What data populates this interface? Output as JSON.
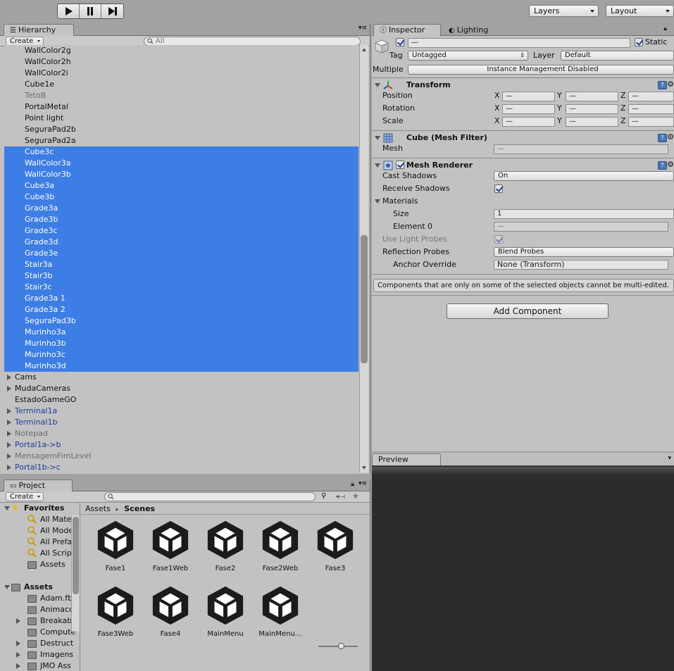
{
  "toolbar": {
    "layers_label": "Layers",
    "layout_label": "Layout"
  },
  "hierarchy": {
    "tab_label": "Hierarchy",
    "create_label": "Create",
    "search_placeholder": "All",
    "rows": [
      {
        "label": "WallColor2g",
        "state": "child"
      },
      {
        "label": "WallColor2h",
        "state": "child"
      },
      {
        "label": "WallColor2i",
        "state": "child"
      },
      {
        "label": "Cube1e",
        "state": "child"
      },
      {
        "label": "TetoB",
        "state": "child-dim"
      },
      {
        "label": "PortalMetal",
        "state": "child"
      },
      {
        "label": "Point light",
        "state": "child"
      },
      {
        "label": "SeguraPad2b",
        "state": "child"
      },
      {
        "label": "SeguraPad2a",
        "state": "child"
      },
      {
        "label": "Cube3c",
        "state": "sel"
      },
      {
        "label": "WallColor3a",
        "state": "sel"
      },
      {
        "label": "WallColor3b",
        "state": "sel"
      },
      {
        "label": "Cube3a",
        "state": "sel"
      },
      {
        "label": "Cube3b",
        "state": "sel"
      },
      {
        "label": "Grade3a",
        "state": "sel"
      },
      {
        "label": "Grade3b",
        "state": "sel"
      },
      {
        "label": "Grade3c",
        "state": "sel"
      },
      {
        "label": "Grade3d",
        "state": "sel"
      },
      {
        "label": "Grade3e",
        "state": "sel"
      },
      {
        "label": "Stair3a",
        "state": "sel"
      },
      {
        "label": "Stair3b",
        "state": "sel"
      },
      {
        "label": "Stair3c",
        "state": "sel"
      },
      {
        "label": "Grade3a 1",
        "state": "sel"
      },
      {
        "label": "Grade3a 2",
        "state": "sel"
      },
      {
        "label": "SeguraPad3b",
        "state": "sel"
      },
      {
        "label": "Murinho3a",
        "state": "sel"
      },
      {
        "label": "Murinho3b",
        "state": "sel"
      },
      {
        "label": "Murinho3c",
        "state": "sel"
      },
      {
        "label": "Murinho3d",
        "state": "sel"
      },
      {
        "label": "Cams",
        "state": "root-fold"
      },
      {
        "label": "MudaCameras",
        "state": "root-fold"
      },
      {
        "label": "EstadoGameGO",
        "state": "root"
      },
      {
        "label": "Terminal1a",
        "state": "root-fold-link"
      },
      {
        "label": "Terminal1b",
        "state": "root-fold-link"
      },
      {
        "label": "Notepad",
        "state": "root-fold-dim"
      },
      {
        "label": "Portal1a->b",
        "state": "root-fold-link"
      },
      {
        "label": "MensagemFimLevel",
        "state": "root-fold-dim"
      },
      {
        "label": "Portal1b->c",
        "state": "root-fold-link"
      }
    ]
  },
  "project": {
    "tab_label": "Project",
    "create_label": "Create",
    "tree": [
      {
        "label": "Favorites",
        "kind": "star",
        "bold": true,
        "indent": 0,
        "fold": "open"
      },
      {
        "label": "All Mater",
        "kind": "search",
        "bold": false,
        "indent": 1,
        "fold": ""
      },
      {
        "label": "All Mode",
        "kind": "search",
        "bold": false,
        "indent": 1,
        "fold": ""
      },
      {
        "label": "All Prefa",
        "kind": "search",
        "bold": false,
        "indent": 1,
        "fold": ""
      },
      {
        "label": "All Script",
        "kind": "search",
        "bold": false,
        "indent": 1,
        "fold": ""
      },
      {
        "label": "Assets",
        "kind": "folder",
        "bold": false,
        "indent": 1,
        "fold": ""
      },
      {
        "label": "",
        "kind": "none",
        "bold": false,
        "indent": 0,
        "fold": ""
      },
      {
        "label": "Assets",
        "kind": "folder",
        "bold": true,
        "indent": 0,
        "fold": "open"
      },
      {
        "label": "Adam.fb",
        "kind": "folder",
        "bold": false,
        "indent": 1,
        "fold": ""
      },
      {
        "label": "Animaco",
        "kind": "folder",
        "bold": false,
        "indent": 1,
        "fold": ""
      },
      {
        "label": "Breakab",
        "kind": "folder",
        "bold": false,
        "indent": 1,
        "fold": "closed"
      },
      {
        "label": "Compute",
        "kind": "folder",
        "bold": false,
        "indent": 1,
        "fold": ""
      },
      {
        "label": "Destruct",
        "kind": "folder",
        "bold": false,
        "indent": 1,
        "fold": "closed"
      },
      {
        "label": "Imagens",
        "kind": "folder",
        "bold": false,
        "indent": 1,
        "fold": "closed"
      },
      {
        "label": "JMO Ass",
        "kind": "folder",
        "bold": false,
        "indent": 1,
        "fold": "closed"
      }
    ],
    "breadcrumb": {
      "root": "Assets",
      "separator": "▸",
      "current": "Scenes"
    },
    "assets": [
      "Fase1",
      "Fase1Web",
      "Fase2",
      "Fase2Web",
      "Fase3",
      "Fase3Web",
      "Fase4",
      "MainMenu",
      "MainMenu…"
    ]
  },
  "inspector": {
    "tab_label": "Inspector",
    "lighting_tab_label": "Lighting",
    "name_value": "—",
    "static_label": "Static",
    "tag_label": "Tag",
    "tag_value": "Untagged",
    "layer_label": "Layer",
    "layer_value": "Default",
    "multiple_label": "Multiple",
    "instance_value": "Instance Management Disabled",
    "transform": {
      "title": "Transform",
      "rows": [
        {
          "label": "Position",
          "x": "—",
          "y": "—",
          "z": "—"
        },
        {
          "label": "Rotation",
          "x": "—",
          "y": "—",
          "z": "—"
        },
        {
          "label": "Scale",
          "x": "—",
          "y": "—",
          "z": "—"
        }
      ],
      "axis_x": "X",
      "axis_y": "Y",
      "axis_z": "Z"
    },
    "mesh_filter": {
      "title": "Cube (Mesh Filter)",
      "mesh_label": "Mesh",
      "mesh_value": "—"
    },
    "mesh_renderer": {
      "title": "Mesh Renderer",
      "cast_shadows_label": "Cast Shadows",
      "cast_shadows_value": "On",
      "receive_shadows_label": "Receive Shadows",
      "materials_label": "Materials",
      "size_label": "Size",
      "size_value": "1",
      "element0_label": "Element 0",
      "element0_value": "—",
      "light_probes_label": "Use Light Probes",
      "reflection_label": "Reflection Probes",
      "reflection_value": "Blend Probes",
      "anchor_label": "Anchor Override",
      "anchor_value": "None (Transform)"
    },
    "help_text": "Components that are only on some of the selected objects cannot be multi-edited.",
    "add_component_label": "Add Component"
  },
  "preview": {
    "tab_label": "Preview"
  }
}
